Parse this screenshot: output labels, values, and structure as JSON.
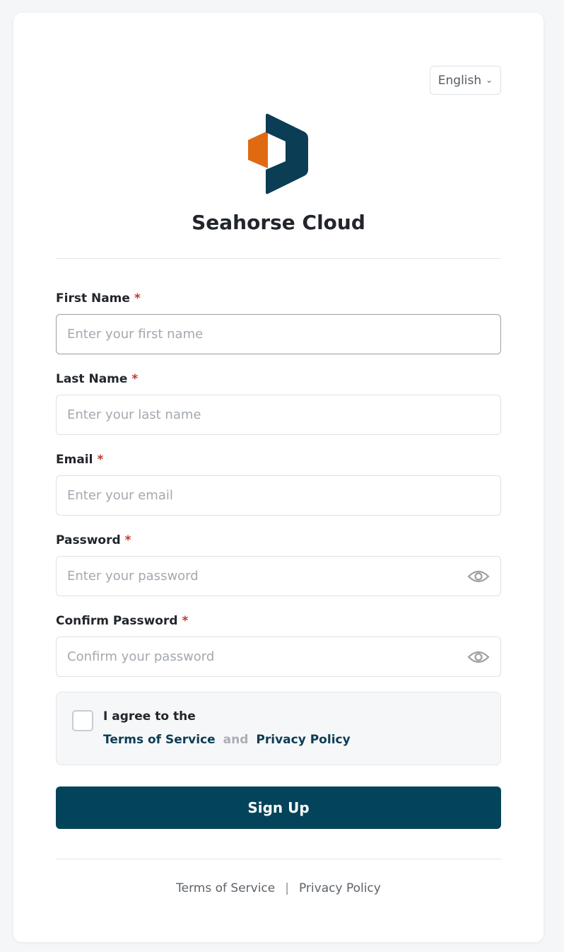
{
  "language": {
    "selected": "English"
  },
  "brand": {
    "name": "Seahorse Cloud"
  },
  "form": {
    "fields": [
      {
        "label": "First Name",
        "required_mark": "*",
        "placeholder": "Enter your first name",
        "value": ""
      },
      {
        "label": "Last Name",
        "required_mark": "*",
        "placeholder": "Enter your last name",
        "value": ""
      },
      {
        "label": "Email",
        "required_mark": "*",
        "placeholder": "Enter your email",
        "value": ""
      },
      {
        "label": "Password",
        "required_mark": "*",
        "placeholder": "Enter your password",
        "value": ""
      },
      {
        "label": "Confirm Password",
        "required_mark": "*",
        "placeholder": "Confirm your password",
        "value": ""
      }
    ],
    "agreement": {
      "text": "I agree to the",
      "terms_link": "Terms of Service",
      "conjunction": "and",
      "privacy_link": "Privacy Policy",
      "checked": false
    },
    "submit_label": "Sign Up"
  },
  "footer": {
    "terms": "Terms of Service",
    "separator": "|",
    "privacy": "Privacy Policy"
  },
  "colors": {
    "primary": "#03445a",
    "logo_dark": "#0b3d55",
    "logo_orange": "#e06a12",
    "required": "#c0392b"
  },
  "icons": {
    "language_chevron": "chevron-down-icon",
    "password_toggle": "eye-icon"
  }
}
